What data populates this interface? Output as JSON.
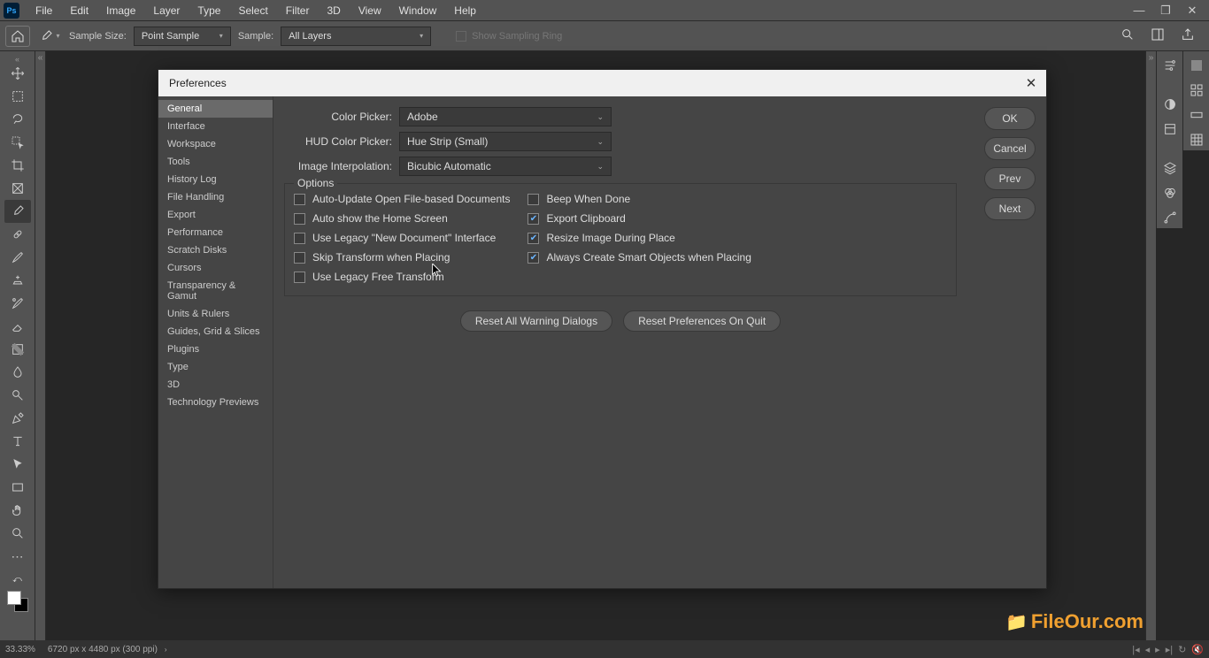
{
  "menubar": {
    "items": [
      "File",
      "Edit",
      "Image",
      "Layer",
      "Type",
      "Select",
      "Filter",
      "3D",
      "View",
      "Window",
      "Help"
    ]
  },
  "optionsbar": {
    "sample_size_label": "Sample Size:",
    "sample_size_value": "Point Sample",
    "sample_label": "Sample:",
    "sample_value": "All Layers",
    "show_sampling_ring": "Show Sampling Ring"
  },
  "dialog": {
    "title": "Preferences",
    "categories": [
      "General",
      "Interface",
      "Workspace",
      "Tools",
      "History Log",
      "File Handling",
      "Export",
      "Performance",
      "Scratch Disks",
      "Cursors",
      "Transparency & Gamut",
      "Units & Rulers",
      "Guides, Grid & Slices",
      "Plugins",
      "Type",
      "3D",
      "Technology Previews"
    ],
    "active_category": 0,
    "color_picker_label": "Color Picker:",
    "color_picker_value": "Adobe",
    "hud_label": "HUD Color Picker:",
    "hud_value": "Hue Strip (Small)",
    "interp_label": "Image Interpolation:",
    "interp_value": "Bicubic Automatic",
    "options_legend": "Options",
    "options_left": [
      {
        "label": "Auto-Update Open File-based Documents",
        "checked": false
      },
      {
        "label": "Auto show the Home Screen",
        "checked": false
      },
      {
        "label": "Use Legacy \"New Document\" Interface",
        "checked": false
      },
      {
        "label": "Skip Transform when Placing",
        "checked": false
      },
      {
        "label": "Use Legacy Free Transform",
        "checked": false
      }
    ],
    "options_right": [
      {
        "label": "Beep When Done",
        "checked": false
      },
      {
        "label": "Export Clipboard",
        "checked": true
      },
      {
        "label": "Resize Image During Place",
        "checked": true
      },
      {
        "label": "Always Create Smart Objects when Placing",
        "checked": true
      }
    ],
    "reset_warnings": "Reset All Warning Dialogs",
    "reset_on_quit": "Reset Preferences On Quit",
    "ok": "OK",
    "cancel": "Cancel",
    "prev": "Prev",
    "next": "Next"
  },
  "statusbar": {
    "zoom": "33.33%",
    "doc": "6720 px x 4480 px (300 ppi)"
  },
  "watermark": "FileOur.com"
}
